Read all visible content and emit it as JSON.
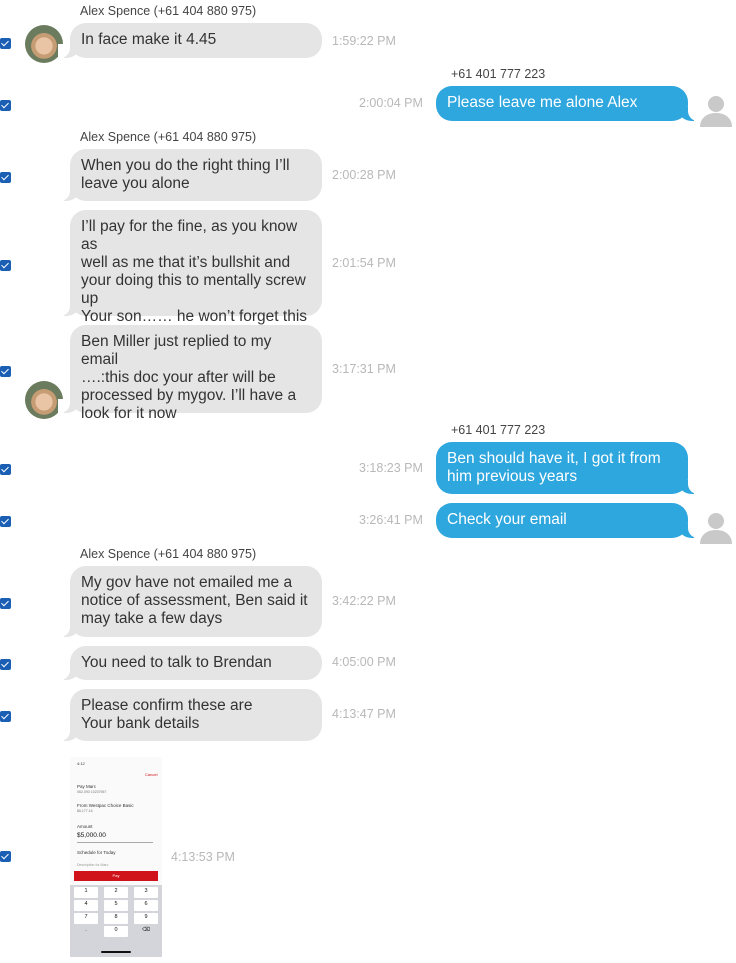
{
  "messages": [
    {
      "sender": "Alex Spence (+61 404 880 975)",
      "text": "In face make it 4.45",
      "time": "1:59:22 PM"
    },
    {
      "sender": "+61 401 777 223",
      "text": "Please leave me alone Alex",
      "time": "2:00:04 PM"
    },
    {
      "sender": "Alex Spence (+61 404 880 975)",
      "text": "When you do the right thing I’ll\nleave you alone",
      "time": "2:00:28 PM"
    },
    {
      "text": "I’ll pay for the fine, as you know as\nwell as me that it’s bullshit and\nyour doing this to mentally screw\nup\nYour son…… he won’t forget this",
      "time": "2:01:54 PM"
    },
    {
      "text": "Ben Miller just replied to my email\n….:this doc your after will be\nprocessed by mygov. I’ll have a\nlook for it now",
      "time": "3:17:31 PM"
    },
    {
      "sender": "+61 401 777 223",
      "text": "Ben should have it, I got it from\nhim previous years",
      "time": "3:18:23 PM"
    },
    {
      "text": "Check your email",
      "time": "3:26:41 PM"
    },
    {
      "sender": "Alex Spence (+61 404 880 975)",
      "text": "My gov have not emailed me a\nnotice of assessment, Ben said it\nmay take a few days",
      "time": "3:42:22 PM"
    },
    {
      "text": "You need to talk to Brendan",
      "time": "4:05:00 PM"
    },
    {
      "text": "Please confirm these are\nYour bank details",
      "time": "4:13:47 PM"
    },
    {
      "time": "4:13:53 PM"
    }
  ],
  "attachment": {
    "status_time": "4:12",
    "cancel": "Cancel",
    "pay_to": "Pay Marc",
    "account_ref": "062-093 10237967",
    "from": "From Westpac Choice Basic",
    "balance": "$6,177.16",
    "amount_label": "Amount",
    "amount": "$5,000.00",
    "schedule": "Schedule for Today",
    "description": "Description for Marc",
    "pay_button": "Pay",
    "keys": [
      "1",
      "2",
      "3",
      "4",
      "5",
      "6",
      "7",
      "8",
      "9",
      ".",
      "0",
      "⌫"
    ]
  },
  "colors": {
    "incoming": "#e5e5e5",
    "outgoing": "#2ea6de",
    "checkbox": "#1a5fb4"
  }
}
